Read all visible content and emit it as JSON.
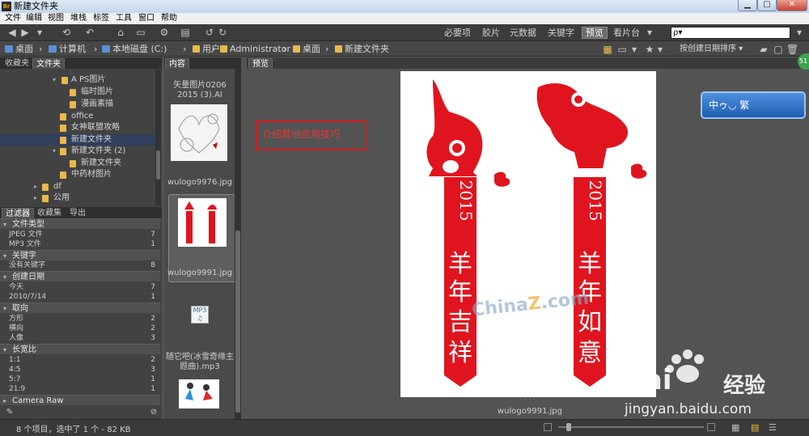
{
  "window": {
    "title": "新建文件夹",
    "app_icon": "Br"
  },
  "menu": [
    "文件",
    "编辑",
    "视图",
    "堆栈",
    "标签",
    "工具",
    "窗口",
    "帮助"
  ],
  "workspaces": [
    "必要项",
    "胶片",
    "元数据",
    "关键字",
    "预览",
    "看片台"
  ],
  "workspace_active": "预览",
  "search": {
    "placeholder": "ρ▾"
  },
  "path": [
    "桌面",
    "计算机",
    "本地磁盘 (C:)",
    "用户",
    "Administrator",
    "桌面",
    "新建文件夹"
  ],
  "sort_label": "按创建日期排序",
  "folders_panel": {
    "tabs": [
      "收藏夹",
      "文件夹"
    ],
    "items": [
      "A PS图片",
      "临时图片",
      "漫画素描",
      "office",
      "女神联盟攻略",
      "新建文件夹",
      "新建文件夹 (2)",
      "新建文件夹",
      "中药材图片",
      "df",
      "公用"
    ]
  },
  "filter_panel": {
    "tabs": [
      "过滤器",
      "收藏集",
      "导出"
    ],
    "groups": [
      {
        "title": "文件类型",
        "items": [
          {
            "n": "JPEG 文件",
            "c": "7"
          },
          {
            "n": "MP3 文件",
            "c": "1"
          }
        ]
      },
      {
        "title": "关键字",
        "items": [
          {
            "n": "没有关键字",
            "c": "8"
          }
        ]
      },
      {
        "title": "创建日期",
        "items": [
          {
            "n": "今天",
            "c": "7"
          },
          {
            "n": "2010/7/14",
            "c": "1"
          }
        ]
      },
      {
        "title": "取向",
        "items": [
          {
            "n": "方形",
            "c": "2"
          },
          {
            "n": "横向",
            "c": "2"
          },
          {
            "n": "人像",
            "c": "3"
          }
        ]
      },
      {
        "title": "长宽比",
        "items": [
          {
            "n": "1:1",
            "c": "2"
          },
          {
            "n": "4:5",
            "c": "3"
          },
          {
            "n": "5:7",
            "c": "1"
          },
          {
            "n": "21:9",
            "c": "1"
          }
        ]
      },
      {
        "title": "Camera Raw",
        "items": []
      }
    ]
  },
  "content_panel": {
    "tab": "内容",
    "items": [
      {
        "caption": "矢量图片0206 2015 (3).AI"
      },
      {
        "caption": "wulogo9976.jpg"
      },
      {
        "caption": "wulogo9991.jpg"
      },
      {
        "caption": "随它吧(冰雪奇缘主题曲).mp3"
      }
    ]
  },
  "preview_panel": {
    "tab": "预览",
    "annotation": "介绍其他应用技巧",
    "file_label": "wulogo9991.jpg",
    "banner_left": [
      "2015",
      "羊",
      "年",
      "吉",
      "祥"
    ],
    "banner_right": [
      "2015",
      "羊",
      "年",
      "如",
      "意"
    ],
    "watermark_china": "China",
    "watermark_z": "Z",
    "watermark_com": ".com",
    "baidu_logo": "Bai",
    "baidu_logo2": "经验",
    "baidu_url": "jingyan.baidu.com",
    "ime_label": "中ゥ◡ 繁",
    "badge_51": "51"
  },
  "status": {
    "text": "8 个项目，选中了 1 个 - 82 KB"
  },
  "colors": {
    "accent_red": "#e0141e",
    "panel_dark": "#424242",
    "selection": "#2f3f5c"
  }
}
